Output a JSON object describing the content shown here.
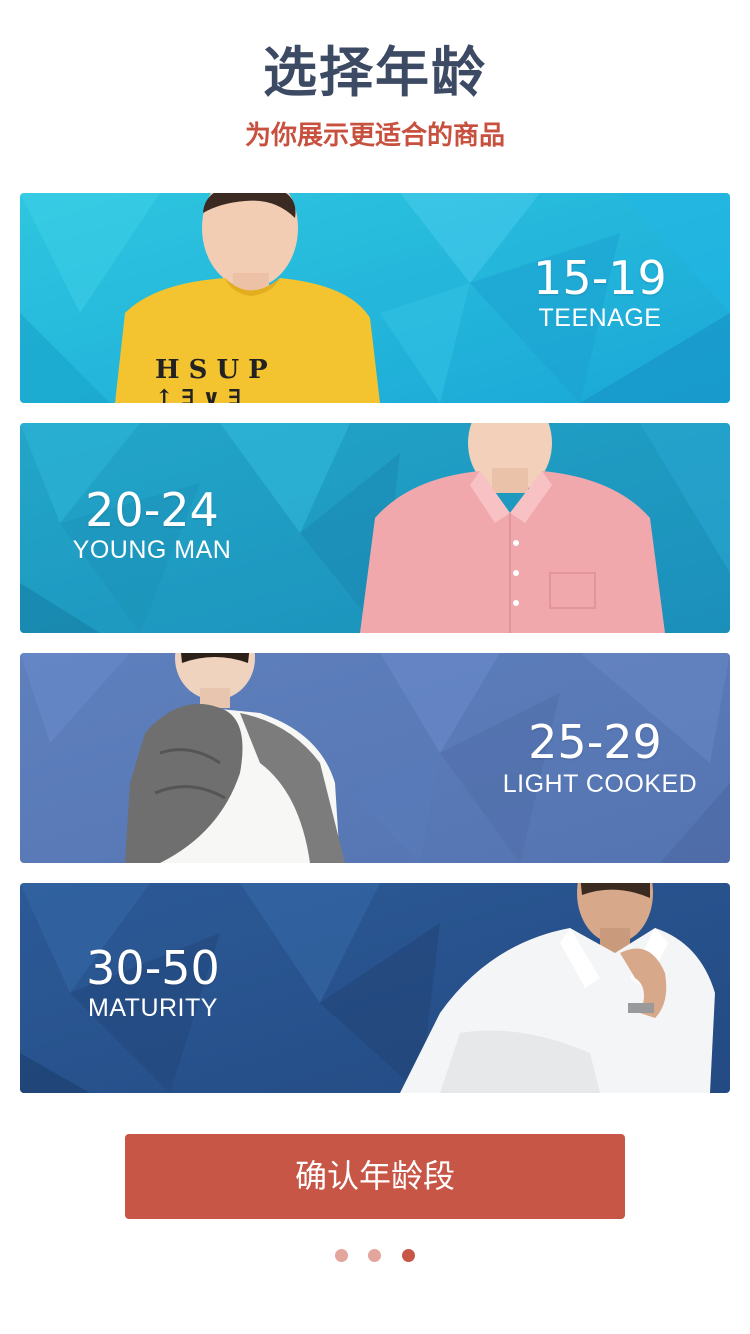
{
  "header": {
    "title": "选择年龄",
    "subtitle": "为你展示更适合的商品"
  },
  "age_cards": [
    {
      "range": "15-19",
      "label": "TEENAGE"
    },
    {
      "range": "20-24",
      "label": "YOUNG MAN"
    },
    {
      "range": "25-29",
      "label": "LIGHT COOKED"
    },
    {
      "range": "30-50",
      "label": "MATURITY"
    }
  ],
  "confirm_button": {
    "label": "确认年龄段"
  },
  "pagination": {
    "total": 3,
    "current": 3
  },
  "colors": {
    "title": "#3c4a63",
    "subtitle": "#c8503f",
    "button": "#c85646",
    "dot_inactive": "#e4a59c",
    "dot_active": "#c85646"
  }
}
